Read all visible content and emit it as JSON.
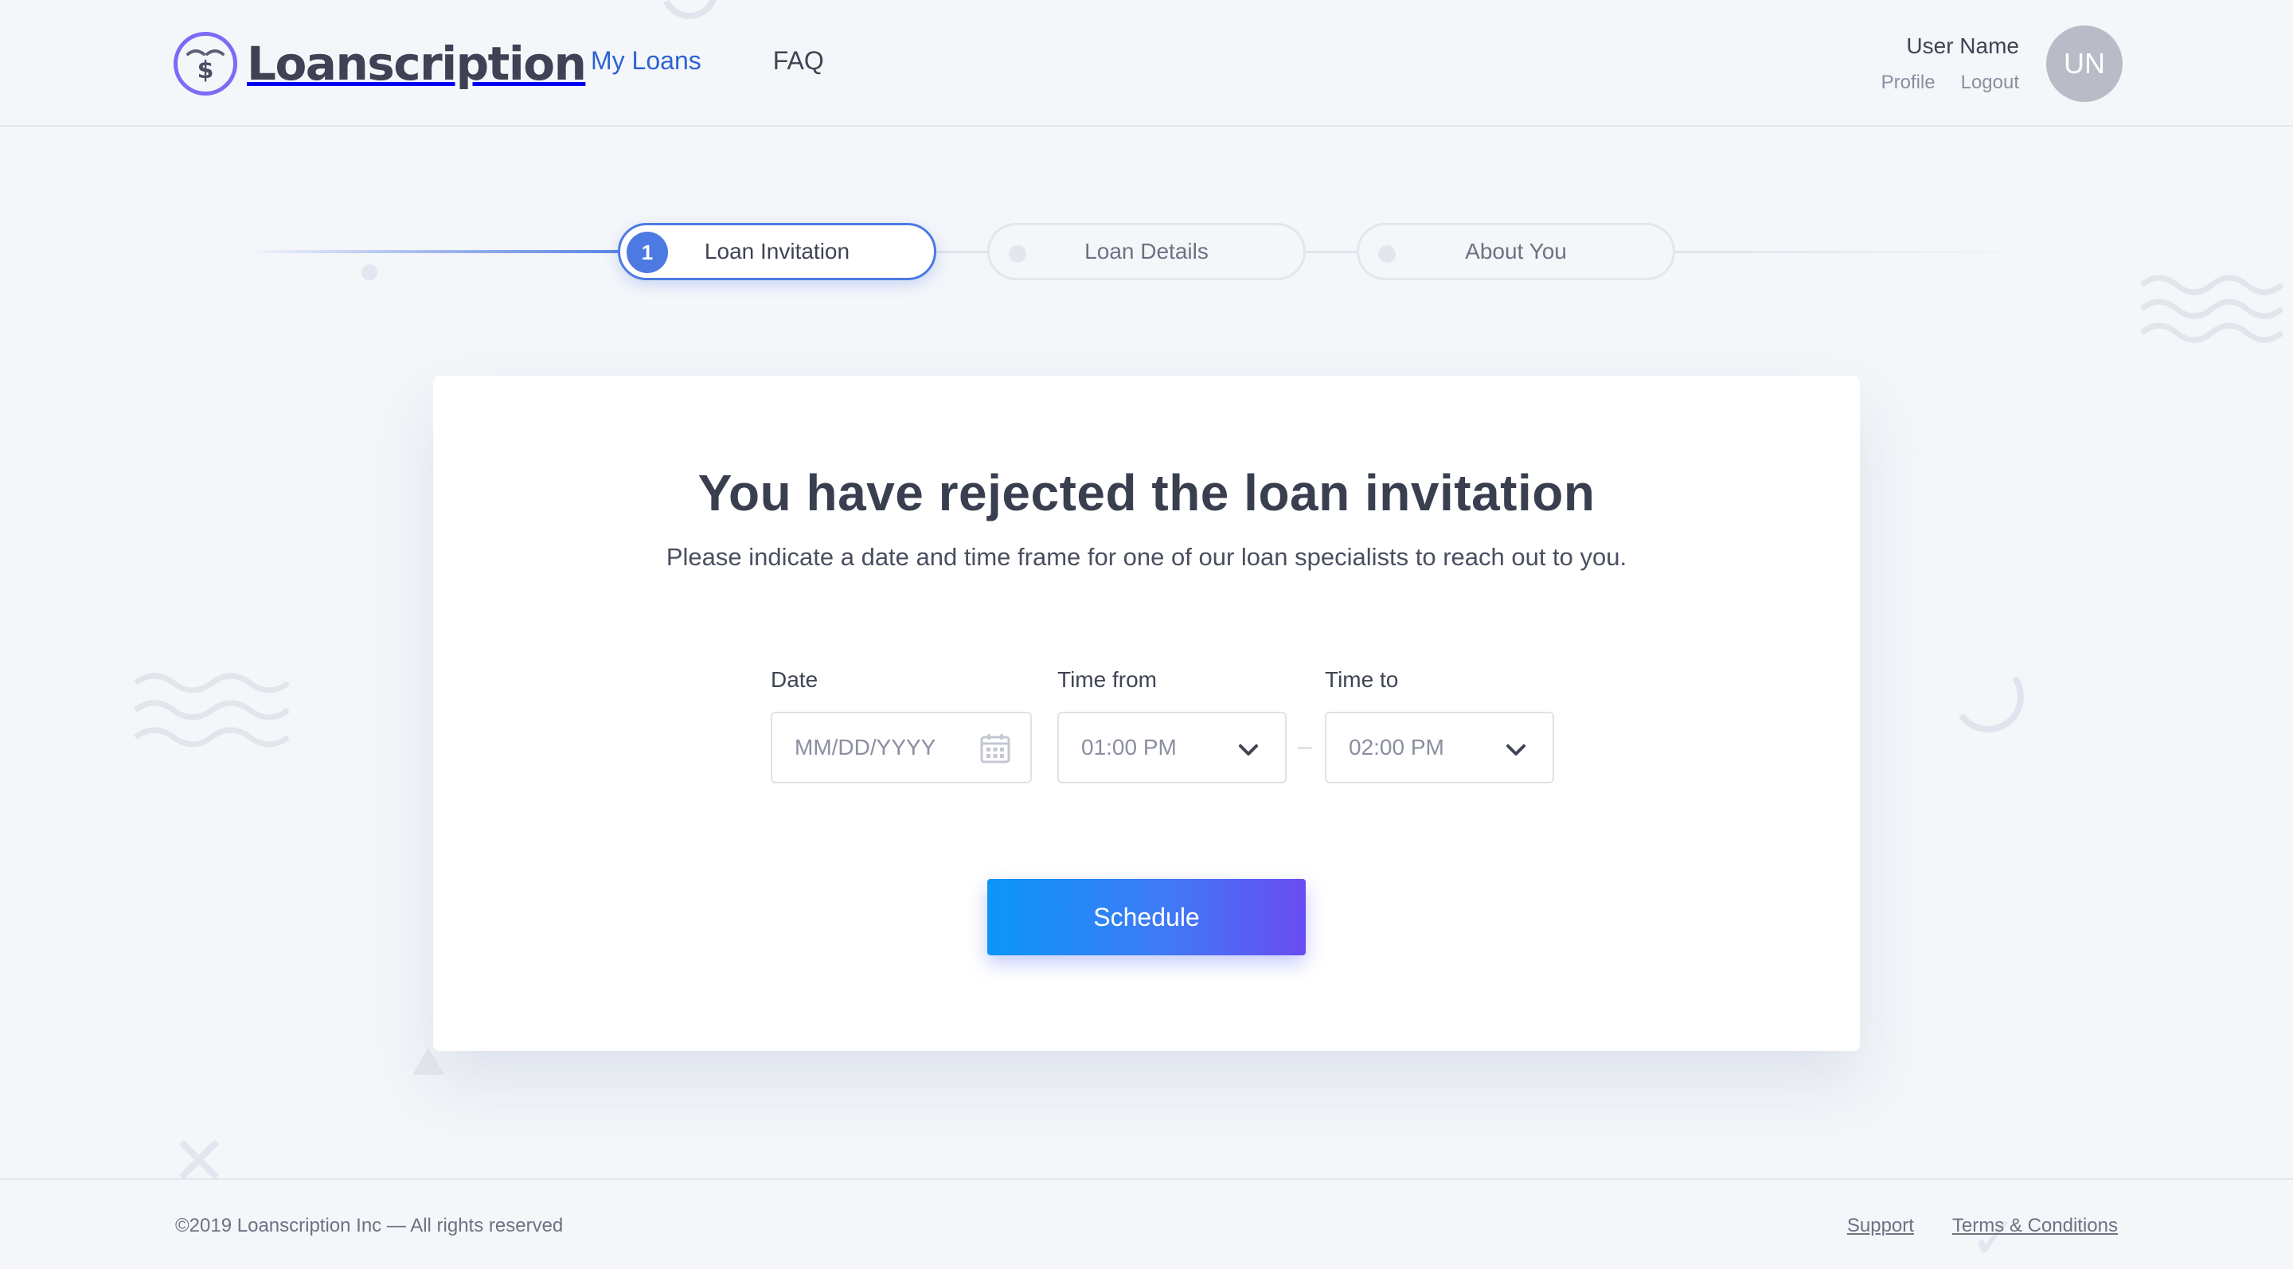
{
  "header": {
    "logo_text": "Loanscription",
    "nav": [
      {
        "label": "My Loans",
        "active": true
      },
      {
        "label": "FAQ",
        "active": false
      }
    ],
    "user": {
      "name": "User Name",
      "profile_label": "Profile",
      "logout_label": "Logout",
      "avatar_initials": "UN"
    }
  },
  "stepper": {
    "steps": [
      {
        "number": "1",
        "label": "Loan Invitation",
        "state": "active"
      },
      {
        "label": "Loan Details",
        "state": "pending"
      },
      {
        "label": "About You",
        "state": "pending"
      }
    ]
  },
  "card": {
    "title": "You have rejected the loan invitation",
    "subtitle": "Please indicate a date and time frame for one of our loan specialists to reach out to you.",
    "date": {
      "label": "Date",
      "placeholder": "MM/DD/YYYY",
      "icon": "calendar-icon"
    },
    "time_from": {
      "label": "Time from",
      "value": "01:00 PM",
      "icon": "chevron-down-icon"
    },
    "time_to": {
      "label": "Time to",
      "value": "02:00 PM",
      "icon": "chevron-down-icon"
    },
    "schedule_label": "Schedule"
  },
  "footer": {
    "copyright": "©2019 Loanscription Inc — All rights reserved",
    "links": [
      "Support",
      "Terms & Conditions"
    ]
  },
  "colors": {
    "accent": "#2d63d4",
    "step_active": "#4d7ae2",
    "button_gradient_start": "#0b96f7",
    "button_gradient_end": "#6a4cf2",
    "logo_ring": "#7d6af5",
    "background": "#f4f6fa"
  }
}
